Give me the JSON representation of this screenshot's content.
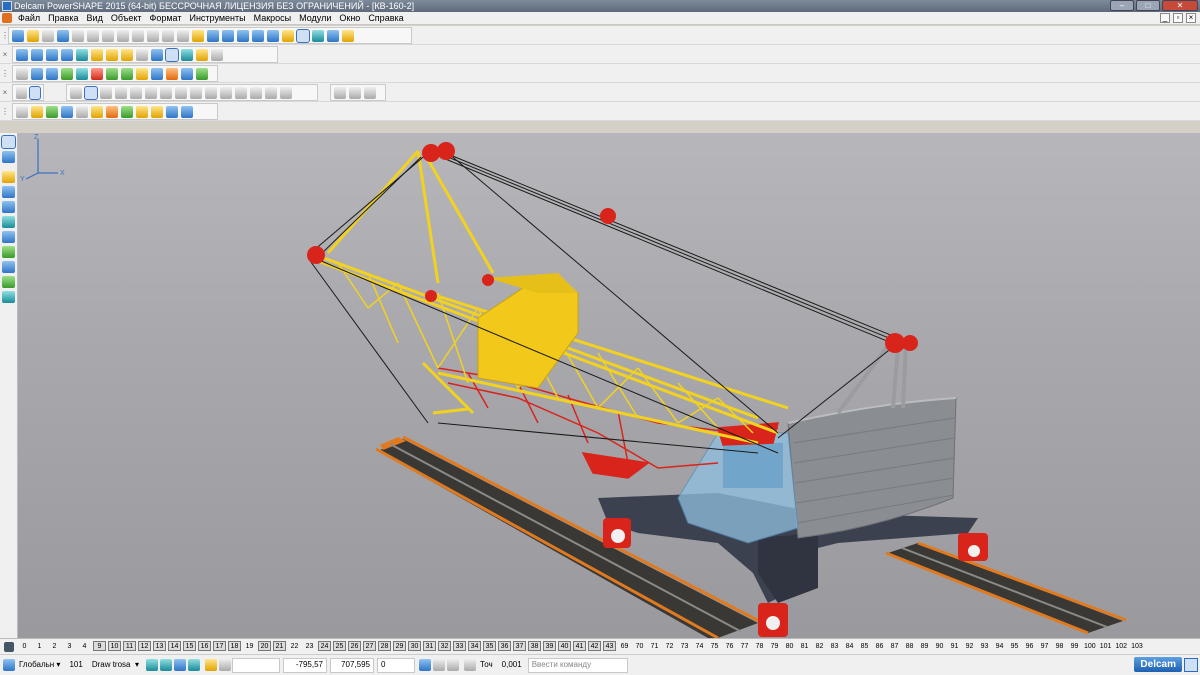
{
  "window": {
    "title": "Delcam PowerSHAPE 2015 (64-bit) БЕССРОЧНАЯ ЛИЦЕНЗИЯ БЕЗ ОГРАНИЧЕНИЙ - [КВ-160-2]"
  },
  "menu": {
    "items": [
      "Файл",
      "Правка",
      "Вид",
      "Объект",
      "Формат",
      "Инструменты",
      "Макросы",
      "Модули",
      "Окно",
      "Справка"
    ]
  },
  "levels": {
    "numbers": [
      "0",
      "1",
      "2",
      "3",
      "4",
      "9",
      "10",
      "11",
      "12",
      "13",
      "14",
      "15",
      "16",
      "17",
      "18",
      "19",
      "20",
      "21",
      "22",
      "23",
      "24",
      "25",
      "26",
      "27",
      "28",
      "29",
      "30",
      "31",
      "32",
      "33",
      "34",
      "35",
      "36",
      "37",
      "38",
      "39",
      "40",
      "41",
      "42",
      "43",
      "69",
      "70",
      "71",
      "72",
      "73",
      "74",
      "75",
      "76",
      "77",
      "78",
      "79",
      "80",
      "81",
      "82",
      "83",
      "84",
      "85",
      "86",
      "87",
      "88",
      "89",
      "90",
      "91",
      "92",
      "93",
      "94",
      "95",
      "96",
      "97",
      "98",
      "99",
      "100",
      "101",
      "102",
      "103"
    ],
    "active": [
      "9",
      "10",
      "11",
      "12",
      "13",
      "14",
      "15",
      "16",
      "17",
      "18",
      "20",
      "21",
      "24",
      "25",
      "26",
      "27",
      "28",
      "29",
      "30",
      "31",
      "32",
      "33",
      "34",
      "35",
      "36",
      "37",
      "38",
      "39",
      "40",
      "41",
      "42",
      "43"
    ]
  },
  "status": {
    "workplane": "Глобальн",
    "level_number": "101",
    "level_name": "Draw trosa",
    "x": "-795,57",
    "y": "707,595",
    "z": "0",
    "tolerance_label": "Точ",
    "tolerance_value": "0,001",
    "command_placeholder": "Ввести команду",
    "brand": "Delcam"
  },
  "icons": {
    "app": "powershape-icon",
    "triad": "axis-triad-icon"
  },
  "colors": {
    "boom": "#f2d21e",
    "sheave": "#d8241a",
    "body": "#8a8d92",
    "rail": "#e07a20",
    "glass": "#8fc0e0"
  }
}
